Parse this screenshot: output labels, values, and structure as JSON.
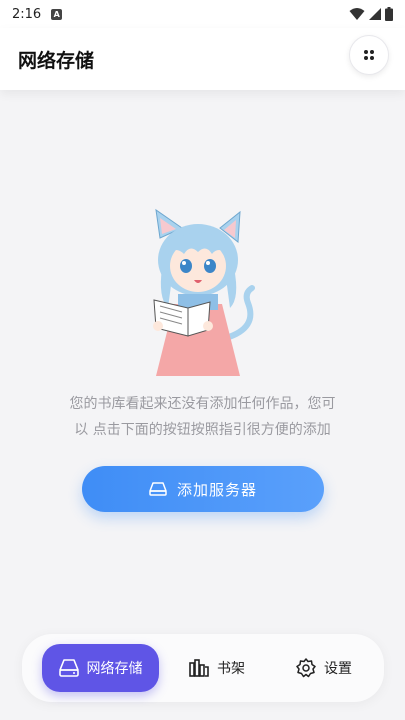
{
  "status_bar": {
    "time": "2:16",
    "notification_badge": "A"
  },
  "header": {
    "title": "网络存储",
    "menu_icon": "dots-grid-icon"
  },
  "empty_state": {
    "illustration": "anime-cat-girl-reading-book",
    "line1": "您的书库看起来还没有添加任何作品，您可",
    "line2": "以 点击下面的按钮按照指引很方便的添加"
  },
  "add_button": {
    "label": "添加服务器",
    "icon": "storage-drive-icon",
    "color_start": "#3f8df6",
    "color_end": "#5aa0fb"
  },
  "bottom_nav": {
    "items": [
      {
        "label": "网络存储",
        "icon": "storage-drive-icon",
        "active": true
      },
      {
        "label": "书架",
        "icon": "bookshelf-icon",
        "active": false
      },
      {
        "label": "设置",
        "icon": "gear-icon",
        "active": false
      }
    ],
    "active_color": "#5f55e6"
  }
}
